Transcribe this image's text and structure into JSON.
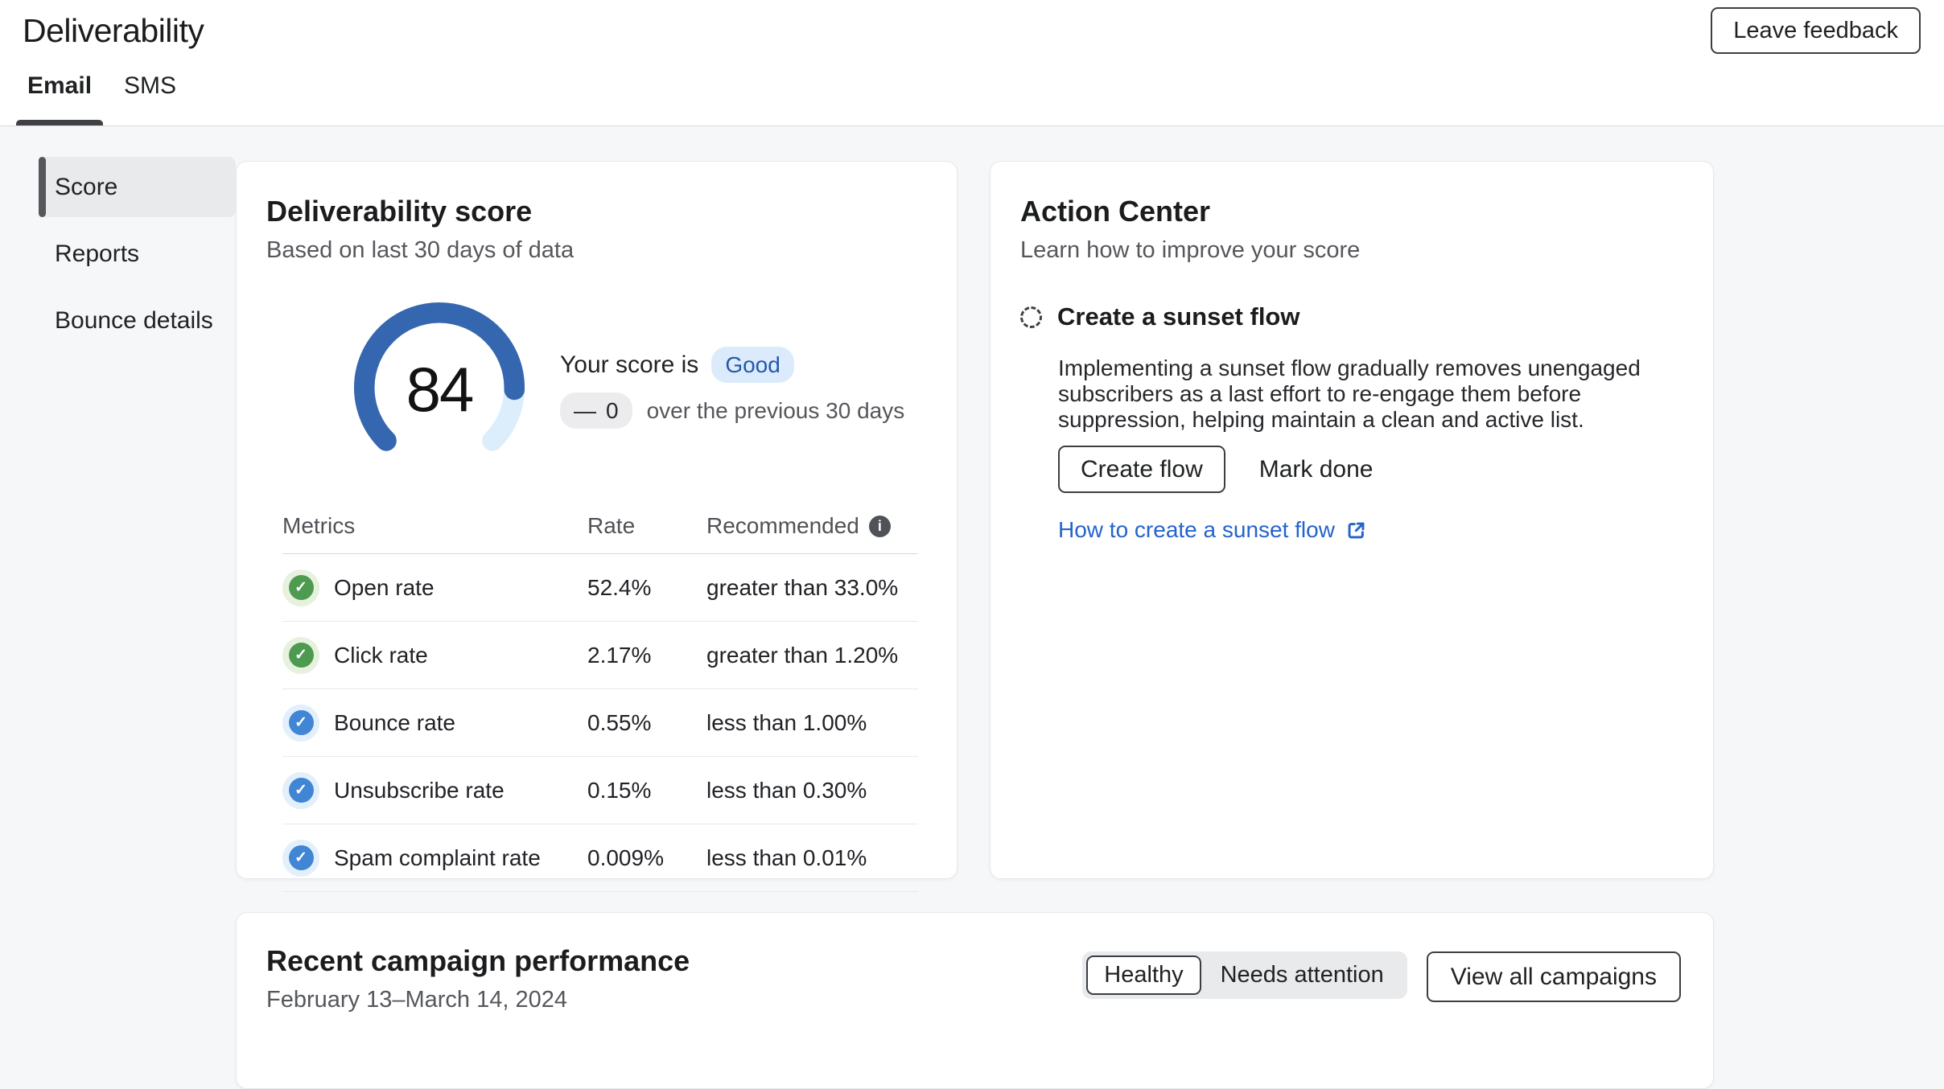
{
  "page": {
    "title": "Deliverability"
  },
  "header": {
    "feedback_button": "Leave feedback",
    "tabs": [
      {
        "label": "Email",
        "active": true
      },
      {
        "label": "SMS",
        "active": false
      }
    ]
  },
  "sidebar": {
    "items": [
      {
        "label": "Score",
        "active": true
      },
      {
        "label": "Reports",
        "active": false
      },
      {
        "label": "Bounce details",
        "active": false
      }
    ]
  },
  "gauge": {
    "value": 84,
    "max": 100
  },
  "score_card": {
    "title": "Deliverability score",
    "subtitle": "Based on last 30 days of data",
    "score": "84",
    "score_label_prefix": "Your score is",
    "score_badge": "Good",
    "delta_dash": "—",
    "delta_value": "0",
    "delta_suffix": "over the previous 30 days",
    "table": {
      "headers": {
        "metrics": "Metrics",
        "rate": "Rate",
        "recommended": "Recommended"
      },
      "check_glyph": "✓",
      "info_glyph": "i",
      "rows": [
        {
          "label": "Open rate",
          "rate": "52.4%",
          "recommended": "greater than 33.0%",
          "status": "good"
        },
        {
          "label": "Click rate",
          "rate": "2.17%",
          "recommended": "greater than 1.20%",
          "status": "good"
        },
        {
          "label": "Bounce rate",
          "rate": "0.55%",
          "recommended": "less than 1.00%",
          "status": "ok"
        },
        {
          "label": "Unsubscribe rate",
          "rate": "0.15%",
          "recommended": "less than 0.30%",
          "status": "ok"
        },
        {
          "label": "Spam complaint rate",
          "rate": "0.009%",
          "recommended": "less than 0.01%",
          "status": "ok"
        }
      ]
    }
  },
  "action_center": {
    "title": "Action Center",
    "subtitle": "Learn how to improve your score",
    "task": {
      "title": "Create a sunset flow",
      "description": "Implementing a sunset flow gradually removes unengaged subscribers as a last effort to re-engage them before suppression, helping maintain a clean and active list.",
      "primary_button": "Create flow",
      "secondary_button": "Mark done",
      "link": "How to create a sunset flow"
    }
  },
  "campaign_card": {
    "title": "Recent campaign performance",
    "subtitle": "February 13–March 14, 2024",
    "filters": [
      {
        "label": "Healthy",
        "active": true
      },
      {
        "label": "Needs attention",
        "active": false
      }
    ],
    "view_all_button": "View all campaigns"
  },
  "colors": {
    "gauge_fill": "#3566b0",
    "gauge_track": "#dcedfc",
    "status_good": "#4e9a51",
    "status_good_halo": "#e6f2dd",
    "status_ok": "#4186d5",
    "status_ok_halo": "#e3effb",
    "badge_bg": "#dcebfb",
    "badge_text": "#2358ac",
    "link": "#2563cb",
    "content_bg": "#f6f7f8"
  }
}
